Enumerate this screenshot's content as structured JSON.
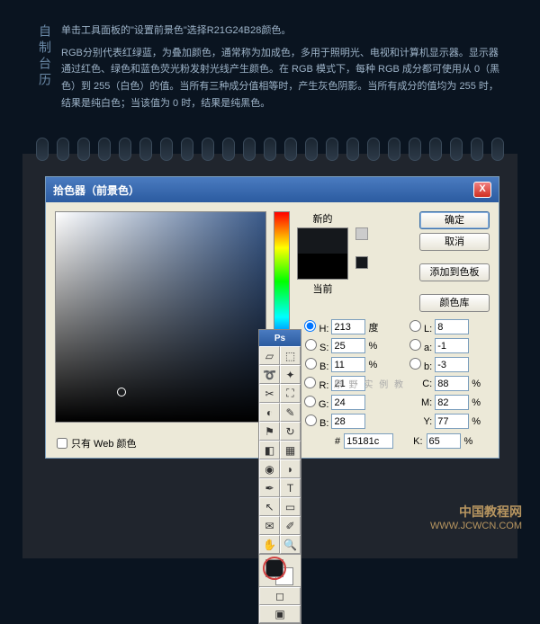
{
  "header": {
    "title_vertical": "自制台历",
    "line1": "单击工具面板的\"设置前景色\"选择R21G24B28颜色。",
    "line2": "RGB分别代表红绿蓝，为叠加颜色，通常称为加成色，多用于照明光、电视和计算机显示器。显示器通过红色、绿色和蓝色荧光粉发射光线产生颜色。在 RGB 模式下，每种 RGB 成分都可使用从 0（黑色）到 255（白色）的值。当所有三种成分值相等时，产生灰色阴影。当所有成分的值均为 255 时，结果是纯白色；当该值为 0 时，结果是纯黑色。"
  },
  "dialog": {
    "title": "拾色器（前景色）",
    "close": "X",
    "new_label": "新的",
    "current_label": "当前",
    "buttons": {
      "ok": "确定",
      "cancel": "取消",
      "add_swatch": "添加到色板",
      "color_lib": "颜色库"
    },
    "fields": {
      "H": {
        "label": "H:",
        "value": "213",
        "unit": "度"
      },
      "S": {
        "label": "S:",
        "value": "25",
        "unit": "%"
      },
      "Bv": {
        "label": "B:",
        "value": "11",
        "unit": "%"
      },
      "R": {
        "label": "R:",
        "value": "21"
      },
      "G": {
        "label": "G:",
        "value": "24"
      },
      "Bb": {
        "label": "B:",
        "value": "28"
      },
      "L": {
        "label": "L:",
        "value": "8"
      },
      "a": {
        "label": "a:",
        "value": "-1"
      },
      "b": {
        "label": "b:",
        "value": "-3"
      },
      "C": {
        "label": "C:",
        "value": "88",
        "unit": "%"
      },
      "M": {
        "label": "M:",
        "value": "82",
        "unit": "%"
      },
      "Y": {
        "label": "Y:",
        "value": "77",
        "unit": "%"
      },
      "K": {
        "label": "K:",
        "value": "65",
        "unit": "%"
      },
      "hex": {
        "label": "#",
        "value": "15181c"
      }
    },
    "web_only": "只有 Web 颜色"
  },
  "toolbox": {
    "header": "Ps"
  },
  "watermark": {
    "line1": "中国教程网",
    "line2": "WWW.JCWCN.COM"
  },
  "wm_faint": "原 野 实 例 教"
}
